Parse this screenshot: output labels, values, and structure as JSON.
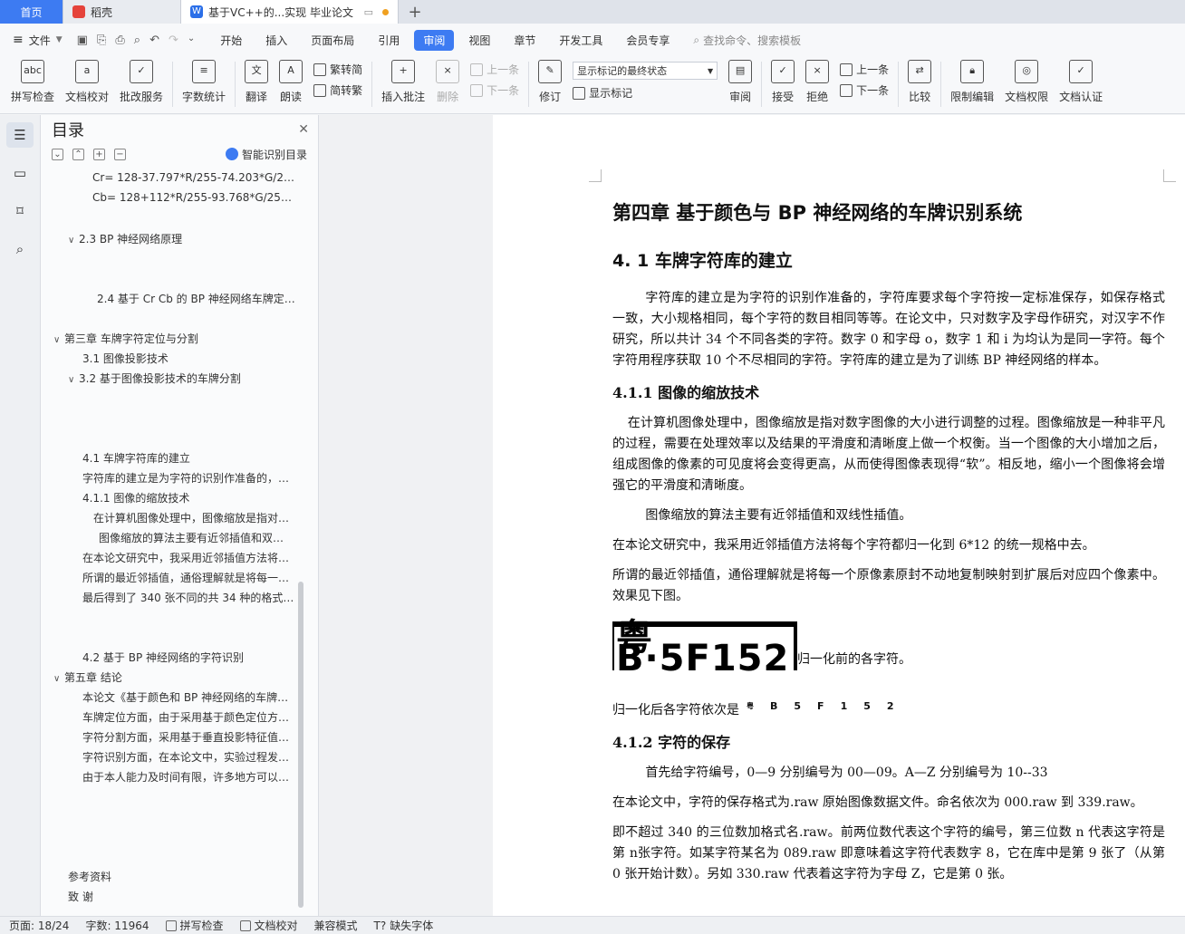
{
  "tabs": {
    "home": "首页",
    "daoke": "稻壳",
    "doc": "基于VC++的...实现 毕业论文",
    "new": "+"
  },
  "menu": {
    "file": "文件",
    "items": [
      "开始",
      "插入",
      "页面布局",
      "引用",
      "审阅",
      "视图",
      "章节",
      "开发工具",
      "会员专享"
    ],
    "active": "审阅",
    "search": "查找命令、搜索模板"
  },
  "ribbon": {
    "spell": "拼写检查",
    "proof": "文档校对",
    "correct": "批改服务",
    "wordcount": "字数统计",
    "translate": "翻译",
    "read": "朗读",
    "trad": "繁转简",
    "simp": "简转繁",
    "insert_comment": "插入批注",
    "delete": "删除",
    "prev": "上一条",
    "next": "下一条",
    "revise": "修订",
    "show_final": "显示标记的最终状态",
    "show_marks": "显示标记",
    "review": "审阅",
    "accept": "接受",
    "reject": "拒绝",
    "prev2": "上一条",
    "next2": "下一条",
    "compare": "比较",
    "restrict": "限制编辑",
    "permission": "文档权限",
    "certify": "文档认证"
  },
  "toc": {
    "title": "目录",
    "smart": "智能识别目录",
    "items": [
      "Cr= 128-37.797*R/255-74.203*G/25…",
      "Cb= 128+112*R/255-93.768*G/255-…",
      "2.3 BP 神经网络原理",
      "2.4  基于 Cr Cb 的 BP 神经网络车牌定…",
      "第三章    车牌字符定位与分割",
      "3.1  图像投影技术",
      "3.2    基于图像投影技术的车牌分割",
      "4.1    车牌字符库的建立",
      "字符库的建立是为字符的识别作准备的，…",
      "4.1.1 图像的缩放技术",
      "在计算机图像处理中，图像缩放是指对…",
      "图像缩放的算法主要有近邻插值和双…",
      "在本论文研究中，我采用近邻插值方法将…",
      "所谓的最近邻插值，通俗理解就是将每一…",
      "最后得到了 340 张不同的共 34 种的格式…",
      "4.2    基于 BP 神经网络的字符识别",
      "第五章    结论",
      "本论文《基于颜色和 BP 神经网络的车牌…",
      "车牌定位方面，由于采用基于颜色定位方…",
      "字符分割方面，采用基于垂直投影特征值…",
      "字符识别方面，在本论文中，实验过程发…",
      "由于本人能力及时间有限，许多地方可以…",
      "参考资料",
      "致  谢"
    ]
  },
  "doc": {
    "chapter": "第四章    基于颜色与 BP 神经网络的车牌识别系统",
    "sec41": "4. 1    车牌字符库的建立",
    "p1": "字符库的建立是为字符的识别作准备的，字符库要求每个字符按一定标准保存，如保存格式一致，大小规格相同，每个字符的数目相同等等。在论文中，只对数字及字母作研究，对汉字不作研究，所以共计 34 个不同各类的字符。数字 0 和字母 o，数字 1 和 i 为均认为是同一字符。每个字符用程序获取 10 个不尽相同的字符。字符库的建立是为了训练 BP 神经网络的样本。",
    "sec411": "4.1.1 图像的缩放技术",
    "p2": "在计算机图像处理中，图像缩放是指对数字图像的大小进行调整的过程。图像缩放是一种非平凡的过程，需要在处理效率以及结果的平滑度和清晰度上做一个权衡。当一个图像的大小增加之后，组成图像的像素的可见度将会变得更高，从而使得图像表现得“软”。相反地，缩小一个图像将会增强它的平滑度和清晰度。",
    "p3": "图像缩放的算法主要有近邻插值和双线性插值。",
    "p4": "在本论文研究中，我采用近邻插值方法将每个字符都归一化到 6*12 的统一规格中去。",
    "p5": "所谓的最近邻插值，通俗理解就是将每一个原像素原封不动地复制映射到扩展后对应四个像素中。效果见下图。",
    "plate": "粤B·5F152",
    "plate_caption": "归一化前的各字符。",
    "after_label": "归一化后各字符依次是",
    "after_chars": [
      "粤",
      "B",
      "5",
      "F",
      "1",
      "5",
      "2"
    ],
    "sec412": "4.1.2 字符的保存",
    "p6": "首先给字符编号，0—9 分别编号为 00—09。A—Z 分别编号为 10--33",
    "p7": "在本论文中，字符的保存格式为.raw 原始图像数据文件。命名依次为 000.raw  到 339.raw。",
    "p8": "即不超过 340 的三位数加格式名.raw。前两位数代表这个字符的编号，第三位数 n 代表这字符是第 n张字符。如某字符某名为 089.raw 即意味着这字符代表数字 8，它在库中是第 9 张了（从第 0 张开始计数）。另如 330.raw 代表着这字符为字母 Z，它是第 0 张。"
  },
  "status": {
    "page": "页面: 18/24",
    "words": "字数: 11964",
    "spell": "拼写检查",
    "proof": "文档校对",
    "compat": "兼容模式",
    "missing_font": "缺失字体"
  }
}
